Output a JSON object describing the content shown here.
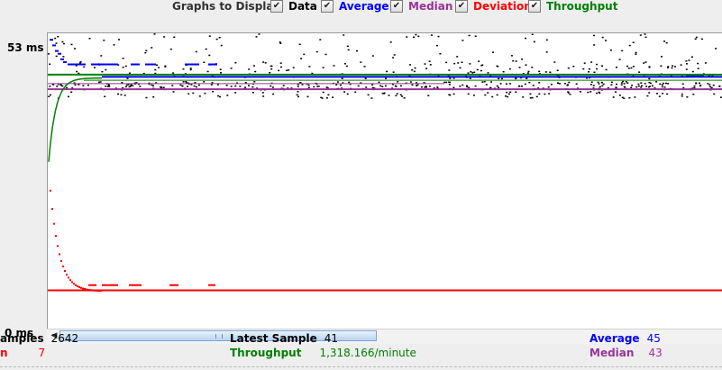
{
  "header": {
    "title": "Graphs to Display",
    "checkboxes": [
      {
        "label": "Data",
        "checked": true,
        "color": "#000000"
      },
      {
        "label": "Average",
        "checked": true,
        "color": "#0000ff"
      },
      {
        "label": "Median",
        "checked": true,
        "color": "#993399"
      },
      {
        "label": "Deviation",
        "checked": true,
        "color": "#ff0000"
      },
      {
        "label": "Throughput",
        "checked": true,
        "color": "#008000"
      }
    ],
    "check_glyph": "✔"
  },
  "graph": {
    "y_max_label": "53 ms",
    "y_min_label": "0 ms",
    "y_range_ms": [
      0,
      53
    ],
    "series_colors": {
      "data": "#000000",
      "average": "#0000ff",
      "median": "#993399",
      "deviation": "#ff0000",
      "throughput": "#008000"
    }
  },
  "stats": {
    "samples_label": "amples",
    "samples_value": "2642",
    "deviation_label": "n",
    "deviation_value": "7",
    "latest_sample_label": "Latest Sample",
    "latest_sample_value": "41",
    "throughput_label": "Throughput",
    "throughput_value": "1,318.166/minute",
    "average_label": "Average",
    "average_value": "45",
    "median_label": "Median",
    "median_value": "43"
  }
}
